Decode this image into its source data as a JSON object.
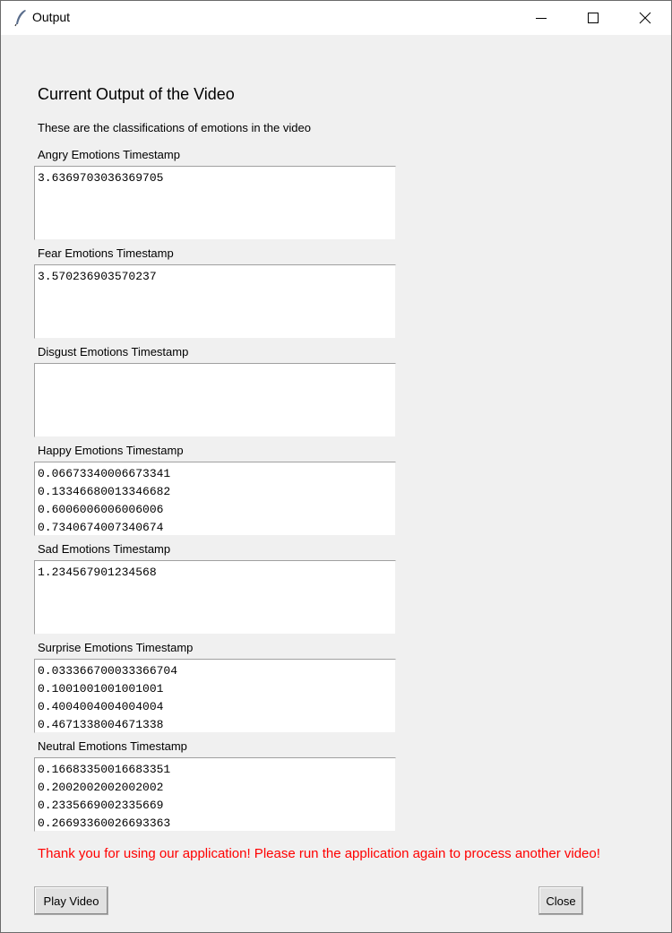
{
  "window": {
    "title": "Output",
    "icons": {
      "app": "feather-icon",
      "minimize": "minimize-icon",
      "maximize": "maximize-icon",
      "close": "close-icon"
    }
  },
  "main": {
    "heading": "Current Output of the Video",
    "subheading": "These are the classifications of emotions in the video",
    "fields": [
      {
        "label": "Angry Emotions Timestamp",
        "lines": [
          "3.6369703036369705"
        ]
      },
      {
        "label": "Fear Emotions Timestamp",
        "lines": [
          "3.570236903570237"
        ]
      },
      {
        "label": "Disgust Emotions Timestamp",
        "lines": []
      },
      {
        "label": "Happy Emotions Timestamp",
        "lines": [
          "0.06673340006673341",
          "0.13346680013346682",
          "0.6006006006006006",
          "0.7340674007340674"
        ]
      },
      {
        "label": "Sad Emotions Timestamp",
        "lines": [
          "1.234567901234568"
        ]
      },
      {
        "label": "Surprise Emotions Timestamp",
        "lines": [
          "0.033366700033366704",
          "0.1001001001001001",
          "0.4004004004004004",
          "0.4671338004671338"
        ]
      },
      {
        "label": "Neutral Emotions Timestamp",
        "lines": [
          "0.16683350016683351",
          "0.2002002002002002",
          "0.2335669002335669",
          "0.26693360026693363"
        ]
      }
    ],
    "footer_message": "Thank you for using our application! Please run the application again to process another video!"
  },
  "buttons": {
    "play_label": "Play Video",
    "close_label": "Close"
  },
  "colors": {
    "background": "#f0f0f0",
    "footer_text": "#ff0000"
  }
}
